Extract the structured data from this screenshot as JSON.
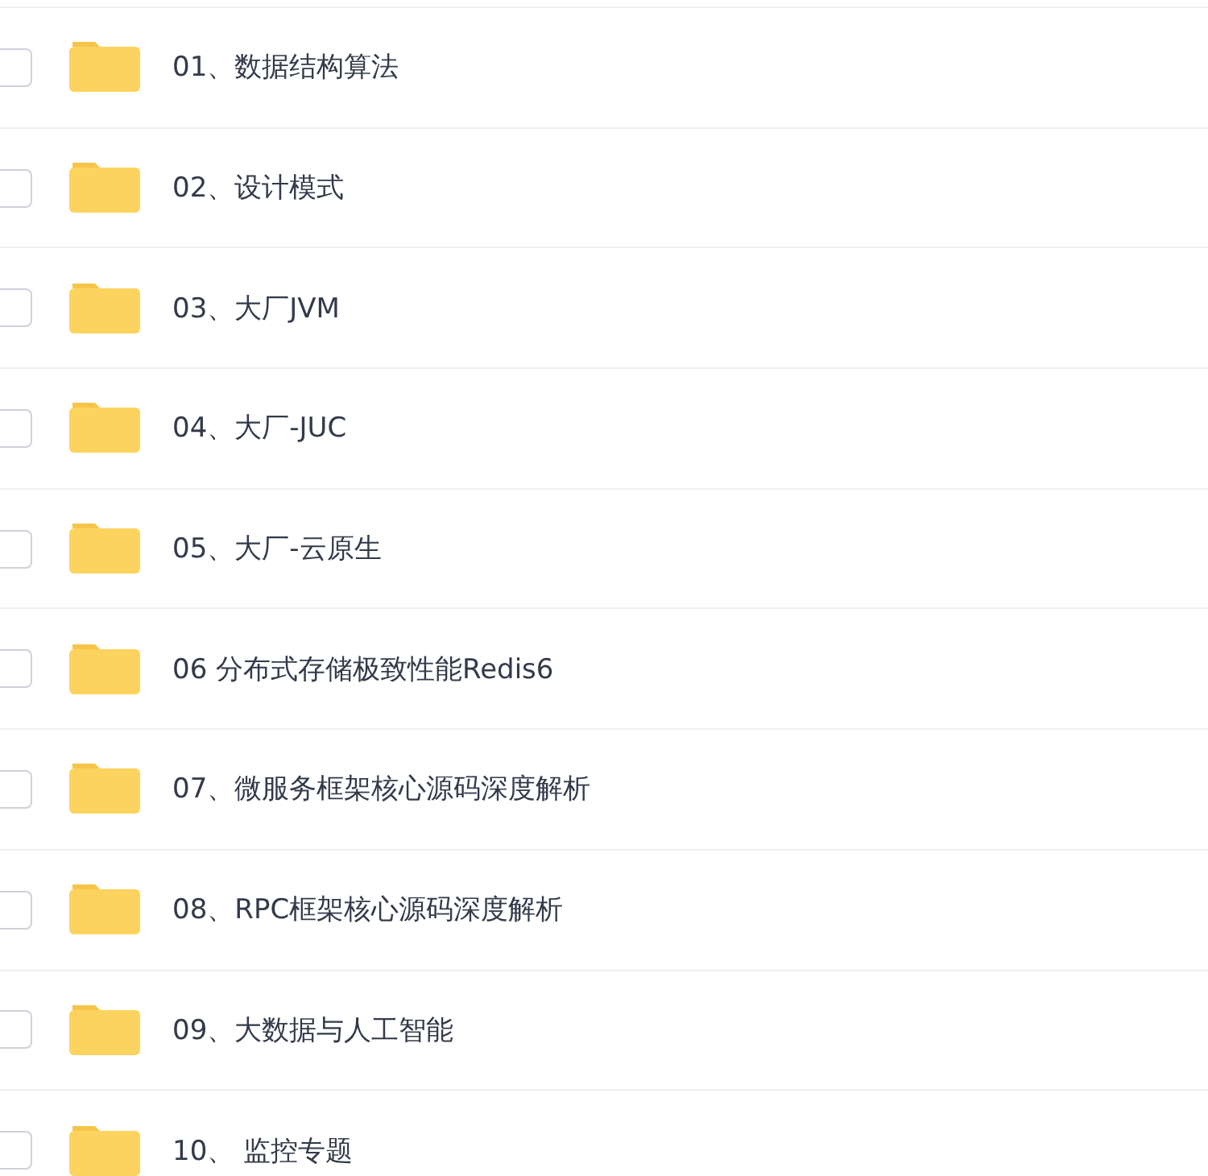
{
  "folders": [
    {
      "name": "01、数据结构算法",
      "checked": false
    },
    {
      "name": "02、设计模式",
      "checked": false
    },
    {
      "name": "03、大厂JVM",
      "checked": false
    },
    {
      "name": "04、大厂-JUC",
      "checked": false
    },
    {
      "name": "05、大厂-云原生",
      "checked": false
    },
    {
      "name": "06 分布式存储极致性能Redis6",
      "checked": false
    },
    {
      "name": "07、微服务框架核心源码深度解析",
      "checked": false
    },
    {
      "name": "08、RPC框架核心源码深度解析",
      "checked": false
    },
    {
      "name": "09、大数据与人工智能",
      "checked": false
    },
    {
      "name": "10、 监控专题",
      "checked": false
    }
  ]
}
